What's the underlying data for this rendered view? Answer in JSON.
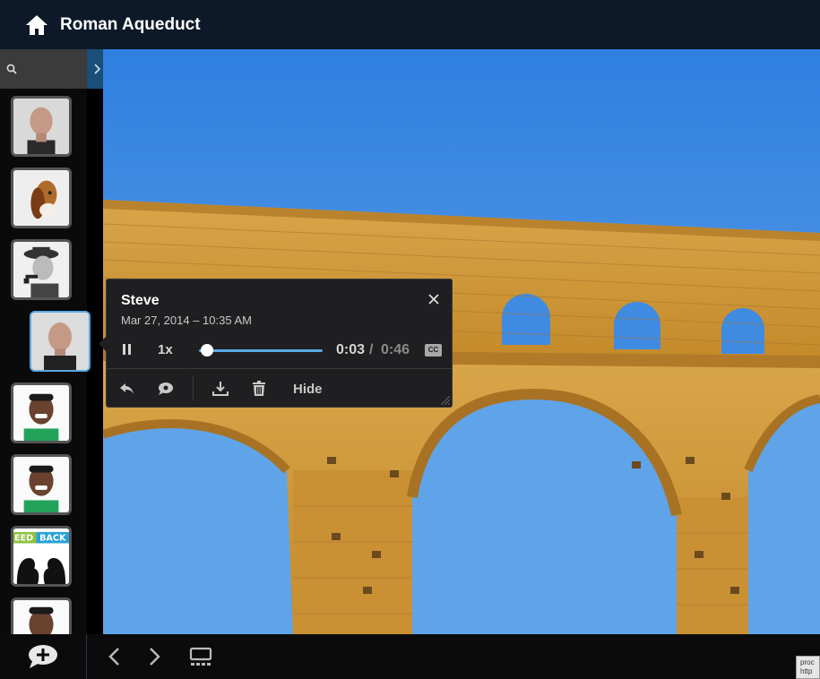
{
  "header": {
    "title": "Roman Aqueduct",
    "home_icon": "home-icon"
  },
  "sidebar": {
    "search": {
      "placeholder": "",
      "value": "",
      "icon": "search-icon"
    },
    "expand_icon": "chevron-right-icon",
    "thumbnails": [
      {
        "name": "man-gray-hair",
        "active": false
      },
      {
        "name": "basset-hound",
        "active": false
      },
      {
        "name": "man-with-pipe",
        "active": false
      },
      {
        "name": "steve",
        "active": true
      },
      {
        "name": "smiling-man-green-shirt",
        "active": false
      },
      {
        "name": "smiling-man-green-shirt-2",
        "active": false
      },
      {
        "name": "feedback-logo",
        "active": false,
        "logo_text": "FEEDBACK"
      },
      {
        "name": "smiling-man-partial",
        "active": false
      }
    ]
  },
  "popup": {
    "author": "Steve",
    "date": "Mar 27, 2014 – 10:35 AM",
    "speed": "1x",
    "time_current": "0:03",
    "time_separator": "/",
    "time_total": "0:46",
    "progress_fraction": 0.065,
    "cc_label": "CC",
    "hide_label": "Hide",
    "tools": [
      "reply-icon",
      "comment-icon",
      "download-icon",
      "trash-icon"
    ]
  },
  "bottom_bar": {
    "add_comment_icon": "add-comment-icon",
    "prev_icon": "chevron-left-icon",
    "next_icon": "chevron-right-icon",
    "slides_icon": "slides-icon",
    "corner_tip": "proc\nhttp"
  },
  "colors": {
    "header_bg": "#0d1929",
    "accent": "#5aa9e6",
    "popup_bg": "#1f1f22",
    "sky": "#3f86de"
  }
}
